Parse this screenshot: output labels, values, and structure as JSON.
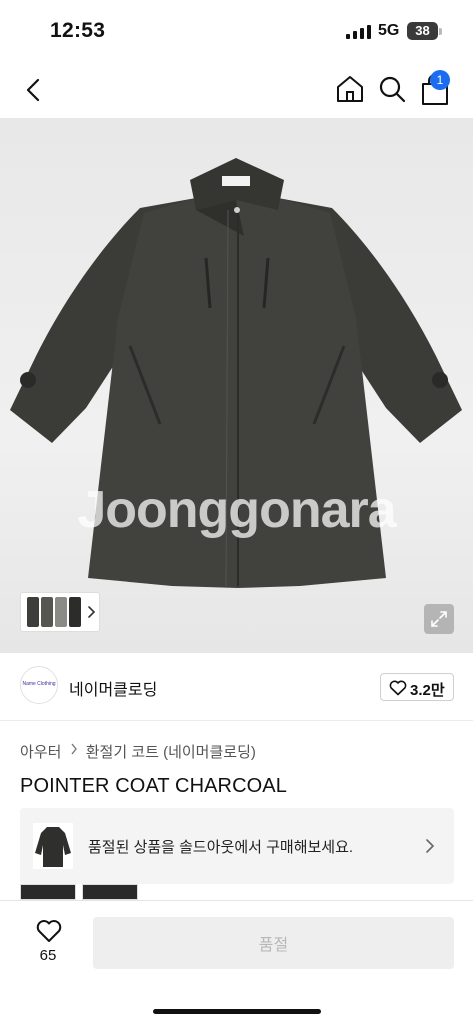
{
  "status_bar": {
    "time": "12:53",
    "network": "5G",
    "battery": "38"
  },
  "nav": {
    "back_icon": "chevron-left-icon",
    "home_icon": "home-icon",
    "search_icon": "search-icon",
    "cart_icon": "shopping-bag-icon",
    "cart_count": "1"
  },
  "hero": {
    "watermark": "Joonggonara",
    "expand_icon": "expand-icon"
  },
  "brand": {
    "logo_text": "Name Clothing",
    "name": "네이머클로딩",
    "like_count": "3.2만"
  },
  "breadcrumb": {
    "items": [
      "아우터",
      "환절기 코트 (네이머클로딩)"
    ]
  },
  "product": {
    "name": "POINTER COAT CHARCOAL"
  },
  "promo": {
    "text": "품절된 상품을 솔드아웃에서 구매해보세요."
  },
  "bottom_bar": {
    "like_count": "65",
    "buy_label": "품절"
  },
  "colors": {
    "accent": "#1c6cf0",
    "coat": "#3d3e3a",
    "button_bg": "#eeeeee"
  }
}
